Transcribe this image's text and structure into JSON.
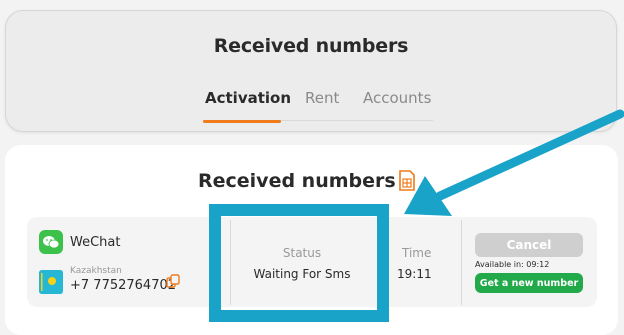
{
  "header": {
    "title": "Received numbers",
    "tabs": [
      {
        "label": "Activation",
        "active": true
      },
      {
        "label": "Rent",
        "active": false
      },
      {
        "label": "Accounts",
        "active": false
      }
    ]
  },
  "main": {
    "title": "Received numbers",
    "export_icon": "spreadsheet-file-icon"
  },
  "order": {
    "service": {
      "name": "WeChat",
      "icon": "wechat-icon"
    },
    "country": "Kazakhstan",
    "phone": "+7 7752764702",
    "status_label": "Status",
    "status_value": "Waiting For Sms",
    "time_label": "Time",
    "time_value": "19:11",
    "cancel_label": "Cancel",
    "available_text": "Available in:  09:12",
    "new_number_label": "Get a new number"
  },
  "colors": {
    "accent": "#f07b1a",
    "highlight": "#1aa3c9",
    "success": "#22aa4a",
    "disabled": "#cfcfcf"
  }
}
